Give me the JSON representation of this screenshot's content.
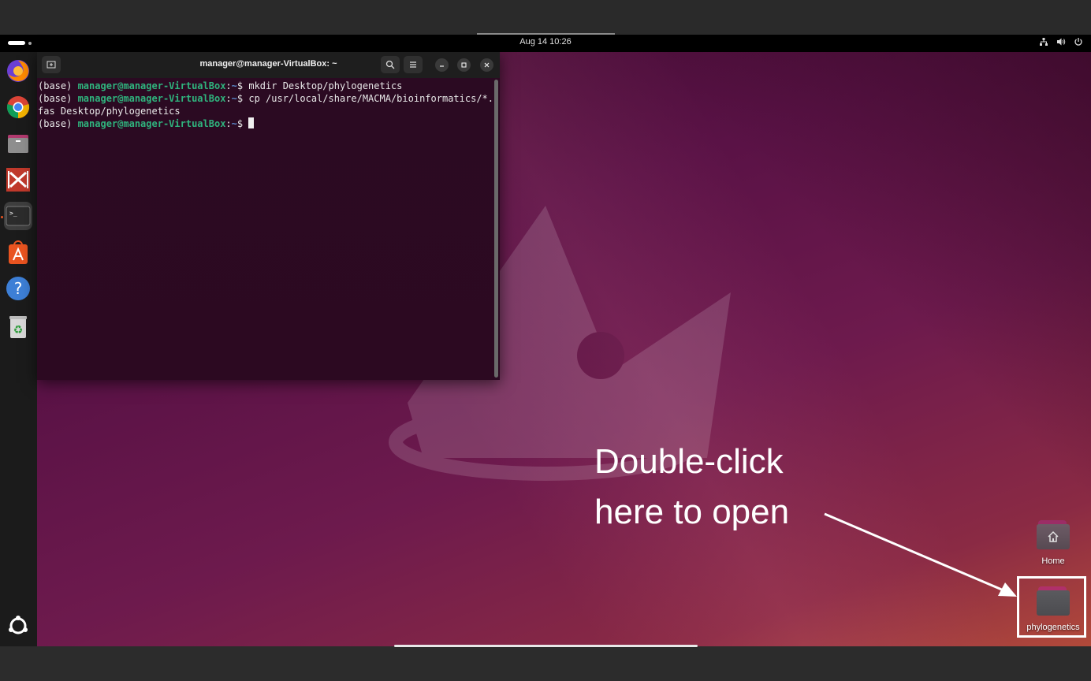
{
  "topbar": {
    "datetime": "Aug 14  10:26",
    "icons": [
      "network-icon",
      "volume-icon",
      "power-icon"
    ]
  },
  "dock": {
    "items": [
      {
        "name": "firefox-icon"
      },
      {
        "name": "chrome-icon"
      },
      {
        "name": "files-icon"
      },
      {
        "name": "macma-icon"
      },
      {
        "name": "terminal-icon",
        "active": true
      },
      {
        "name": "app-center-icon"
      },
      {
        "name": "help-icon"
      },
      {
        "name": "trash-icon"
      },
      {
        "name": "show-apps-icon"
      }
    ]
  },
  "terminal": {
    "title": "manager@manager-VirtualBox: ~",
    "lines": [
      {
        "prefix": "(base) ",
        "user": "manager@manager-VirtualBox",
        "sep": ":",
        "path": "~",
        "dollar": "$ ",
        "cmd": "mkdir Desktop/phylogenetics"
      },
      {
        "prefix": "(base) ",
        "user": "manager@manager-VirtualBox",
        "sep": ":",
        "path": "~",
        "dollar": "$ ",
        "cmd": "cp /usr/local/share/MACMA/bioinformatics/*."
      },
      {
        "plain": "fas Desktop/phylogenetics"
      },
      {
        "prefix": "(base) ",
        "user": "manager@manager-VirtualBox",
        "sep": ":",
        "path": "~",
        "dollar": "$ ",
        "cmd": ""
      }
    ]
  },
  "desktop": {
    "icons": [
      {
        "label": "Home"
      },
      {
        "label": "phylogenetics"
      }
    ]
  },
  "annotation": {
    "line1": "Double-click",
    "line2": "here to open"
  },
  "colors": {
    "prompt_user": "#2fb37d",
    "prompt_path": "#5a87c8",
    "accent": "#e95420"
  }
}
